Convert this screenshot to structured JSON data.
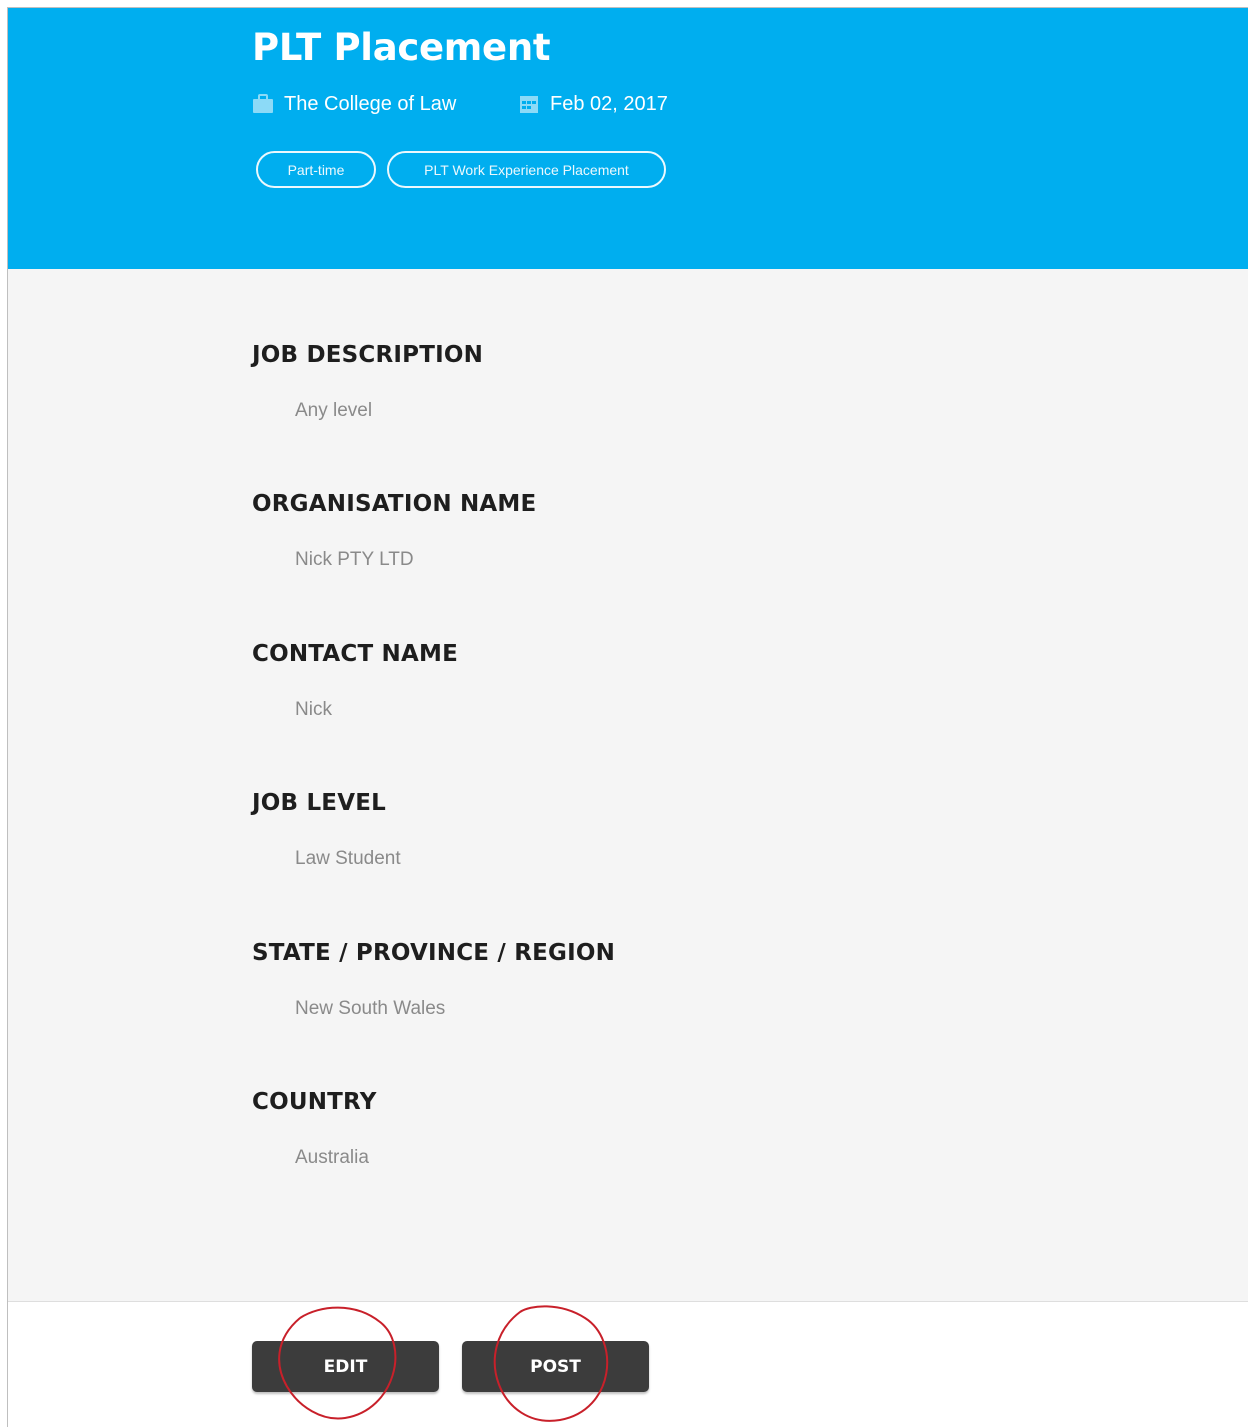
{
  "header": {
    "title": "PLT Placement",
    "organisation": "The College of Law",
    "date": "Feb 02, 2017",
    "tags": [
      "Part-time",
      "PLT Work Experience Placement"
    ],
    "accent_color": "#00aeef"
  },
  "fields": [
    {
      "label": "JOB DESCRIPTION",
      "value": "Any level"
    },
    {
      "label": "ORGANISATION NAME",
      "value": "Nick PTY LTD"
    },
    {
      "label": "CONTACT NAME",
      "value": "Nick"
    },
    {
      "label": "JOB LEVEL",
      "value": "Law Student"
    },
    {
      "label": "STATE / PROVINCE / REGION",
      "value": "New South Wales"
    },
    {
      "label": "COUNTRY",
      "value": "Australia"
    }
  ],
  "actions": {
    "edit_label": "EDIT",
    "post_label": "POST"
  },
  "icons": {
    "organisation": "briefcase-icon",
    "date": "calendar-icon"
  },
  "annotation_color": "#c8202a"
}
